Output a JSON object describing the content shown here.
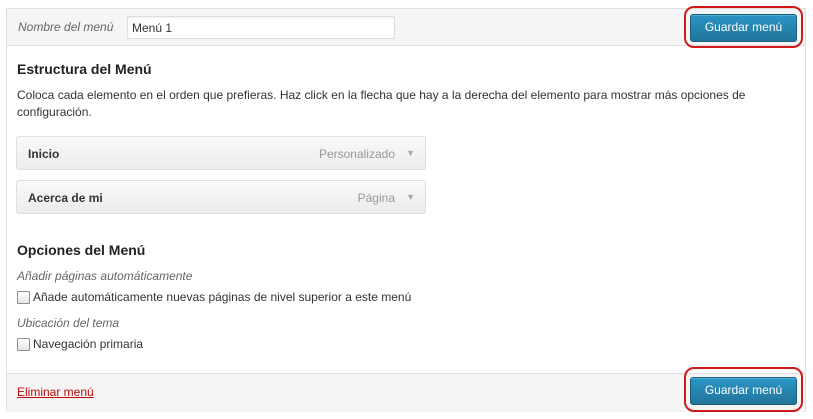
{
  "header": {
    "menu_name_label": "Nombre del menú",
    "menu_name_value": "Menú 1",
    "save_label": "Guardar menú"
  },
  "structure": {
    "title": "Estructura del Menú",
    "description": "Coloca cada elemento en el orden que prefieras. Haz click en la flecha que hay a la derecha del elemento para mostrar más opciones de configuración.",
    "items": [
      {
        "title": "Inicio",
        "type": "Personalizado"
      },
      {
        "title": "Acerca de mi",
        "type": "Página"
      }
    ]
  },
  "options": {
    "title": "Opciones del Menú",
    "auto_add_label": "Añadir páginas automáticamente",
    "auto_add_checkbox": {
      "label": "Añade automáticamente nuevas páginas de nivel superior a este menú",
      "checked": false
    },
    "theme_location_label": "Ubicación del tema",
    "primary_nav_checkbox": {
      "label": "Navegación primaria",
      "checked": false
    }
  },
  "footer": {
    "delete_label": "Eliminar menú",
    "save_label": "Guardar menú"
  },
  "colors": {
    "button_blue": "#21759b",
    "highlight_ring": "#d01a1a",
    "delete_link": "#bc0b0b"
  },
  "icons": {
    "item_toggle": "triangle-down-icon"
  }
}
